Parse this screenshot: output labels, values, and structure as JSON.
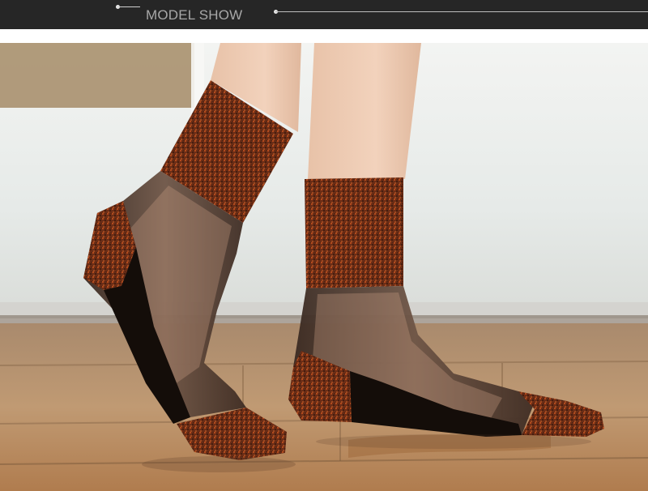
{
  "header": {
    "title": "MODEL SHOW"
  },
  "photo": {
    "subject": "legs-wearing-sheer-black-socks-with-copper-glitter-cuffs-heels-and-toes",
    "colors": {
      "header_bg": "#262626",
      "sock_sheer": "#1a1410",
      "sock_glitter": "#8a3c1c",
      "floor_wood": "#b48a63",
      "backdrop": "#e9ecea"
    }
  }
}
